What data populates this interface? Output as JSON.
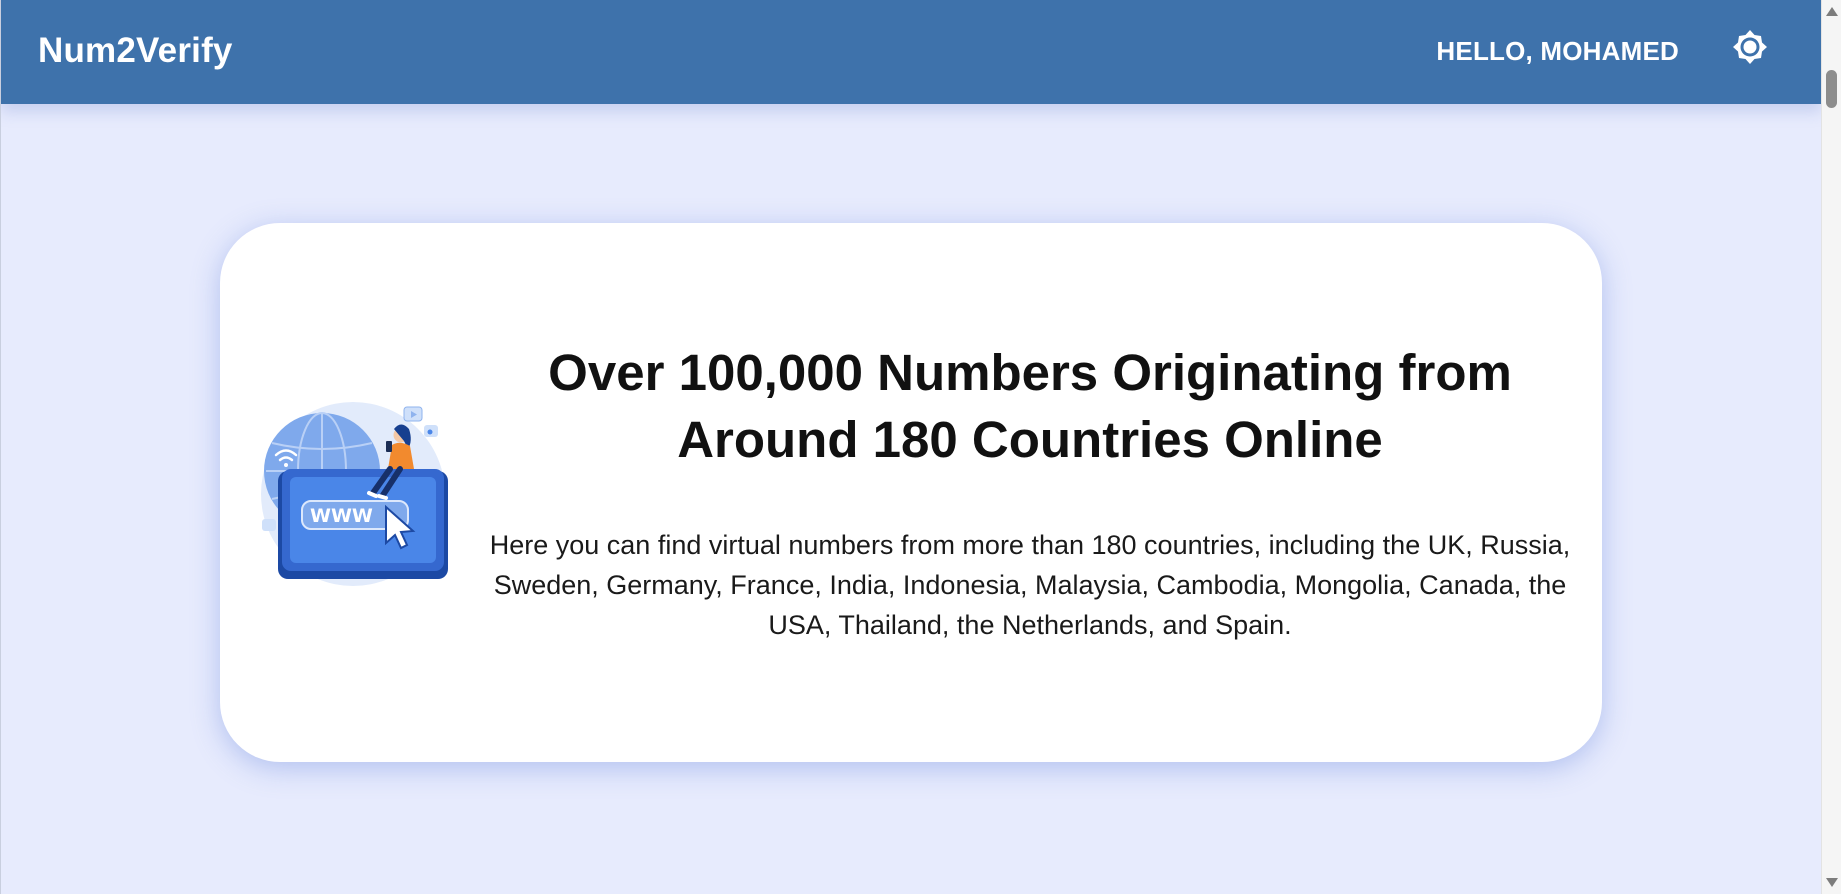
{
  "header": {
    "brand": "Num2Verify",
    "greeting": "HELLO, MOHAMED",
    "theme_toggle_icon": "sun-icon"
  },
  "hero": {
    "title": "Over 100,000 Numbers Originating from Around 180 Countries Online",
    "description": "Here you can find virtual numbers from more than 180 countries, including the UK, Russia, Sweden, Germany, France, India, Indonesia, Malaysia, Cambodia, Mongolia, Canada, the USA, Thailand, the Netherlands, and Spain.",
    "illustration": {
      "icon": "www-laptop-illustration",
      "label": "WWW"
    }
  },
  "colors": {
    "header_bg": "#3e72ab",
    "page_bg": "#e7ebfd",
    "card_bg": "#ffffff",
    "accent_blue": "#4a86e8"
  }
}
